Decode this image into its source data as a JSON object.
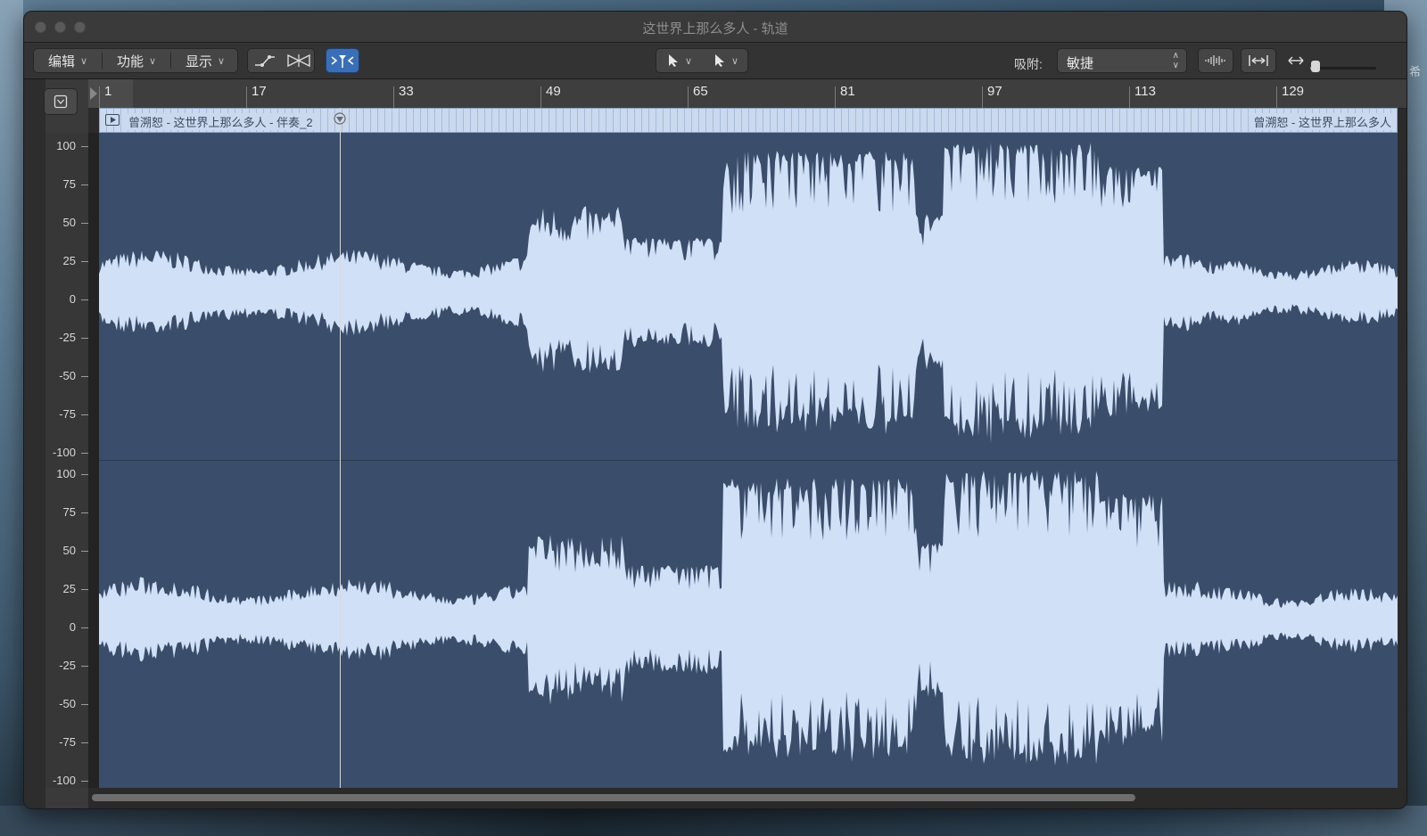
{
  "window": {
    "title": "这世界上那么多人 - 轨道"
  },
  "toolbar": {
    "edit_label": "编辑",
    "function_label": "功能",
    "view_label": "显示",
    "snap_label": "吸附:",
    "snap_value": "敏捷"
  },
  "ruler": {
    "bars": [
      "1",
      "17",
      "33",
      "49",
      "65",
      "81",
      "97",
      "113",
      "129"
    ]
  },
  "region": {
    "name": "曾溯恕 - 这世界上那么多人 - 伴奏_2",
    "name_right": "曾溯恕 - 这世界上那么多人"
  },
  "amplitude_scale": {
    "top_channel": [
      "100",
      "75",
      "50",
      "25",
      "0",
      "-25",
      "-50",
      "-75",
      "-100"
    ],
    "bottom_channel": [
      "100",
      "75",
      "50",
      "25",
      "0",
      "-25",
      "-50",
      "-75",
      "-100"
    ]
  },
  "desktop": {
    "edge_glyph": "希"
  },
  "colors": {
    "waveform": "#cfe0f7",
    "region_bg": "#3a4d6b",
    "region_header": "#cad9ee"
  },
  "icons": {
    "edit_chevron": "chevron-down-icon",
    "automation": "automation-curve-icon",
    "flex": "flex-mode-icon",
    "catch": "catch-playhead-icon",
    "pointer_tool": "pointer-tool-icon",
    "alt_tool": "pointer-alt-tool-icon",
    "waveform_zoom": "waveform-zoom-icon",
    "fit": "fit-to-window-icon",
    "hzoom": "horizontal-zoom-icon"
  }
}
